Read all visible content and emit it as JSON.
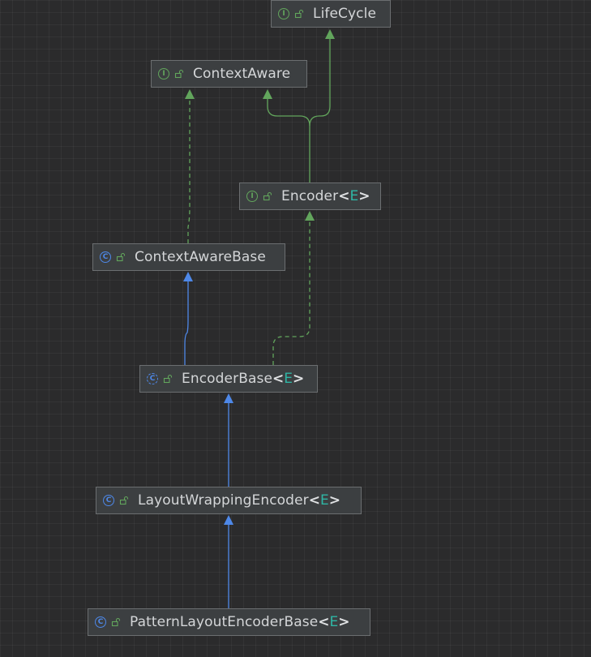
{
  "colors": {
    "background": "#2b2b2c",
    "node_fill": "#3c3f41",
    "node_border": "#6b6e70",
    "interface_green": "#62a55c",
    "class_blue": "#4e88e8",
    "type_param_teal": "#2fb6a5",
    "text": "#d4d6d8"
  },
  "nodes": {
    "lifecycle": {
      "name": "LifeCycle",
      "kind": "interface",
      "kind_icon": "interface-icon",
      "kind_letter": "I",
      "access_icon": "open-lock-icon"
    },
    "context_aware": {
      "name": "ContextAware",
      "kind": "interface",
      "kind_icon": "interface-icon",
      "kind_letter": "I",
      "access_icon": "open-lock-icon"
    },
    "encoder": {
      "name": "Encoder",
      "type_open": "<",
      "type_param": "E",
      "type_close": ">",
      "kind": "interface",
      "kind_icon": "interface-icon",
      "kind_letter": "I",
      "access_icon": "open-lock-icon"
    },
    "context_aware_base": {
      "name": "ContextAwareBase",
      "kind": "class",
      "kind_icon": "class-icon",
      "kind_letter": "C",
      "access_icon": "open-lock-icon"
    },
    "encoder_base": {
      "name": "EncoderBase",
      "type_open": "<",
      "type_param": "E",
      "type_close": ">",
      "kind": "abstract-class",
      "kind_icon": "abstract-class-icon",
      "kind_letter": "C",
      "access_icon": "open-lock-icon"
    },
    "layout_wrapping_encoder": {
      "name": "LayoutWrappingEncoder",
      "type_open": "<",
      "type_param": "E",
      "type_close": ">",
      "kind": "class",
      "kind_icon": "class-icon",
      "kind_letter": "C",
      "access_icon": "open-lock-icon"
    },
    "pattern_layout_encoder_base": {
      "name": "PatternLayoutEncoderBase",
      "type_open": "<",
      "type_param": "E",
      "type_close": ">",
      "kind": "class",
      "kind_icon": "class-icon",
      "kind_letter": "C",
      "access_icon": "open-lock-icon"
    }
  },
  "edges": [
    {
      "from": "encoder",
      "to": "lifecycle",
      "relation": "extends-interface",
      "style": "solid",
      "color": "#62a55c"
    },
    {
      "from": "encoder",
      "to": "context_aware",
      "relation": "extends-interface",
      "style": "solid",
      "color": "#62a55c"
    },
    {
      "from": "context_aware_base",
      "to": "context_aware",
      "relation": "implements",
      "style": "dashed",
      "color": "#62a55c"
    },
    {
      "from": "encoder_base",
      "to": "context_aware_base",
      "relation": "extends",
      "style": "solid",
      "color": "#4e88e8"
    },
    {
      "from": "encoder_base",
      "to": "encoder",
      "relation": "implements",
      "style": "dashed",
      "color": "#62a55c"
    },
    {
      "from": "layout_wrapping_encoder",
      "to": "encoder_base",
      "relation": "extends",
      "style": "solid",
      "color": "#4e88e8"
    },
    {
      "from": "pattern_layout_encoder_base",
      "to": "layout_wrapping_encoder",
      "relation": "extends",
      "style": "solid",
      "color": "#4e88e8"
    }
  ]
}
